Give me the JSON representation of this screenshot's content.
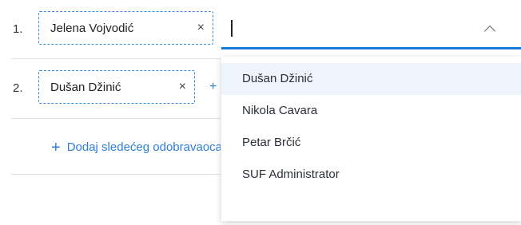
{
  "rows": [
    {
      "number": "1.",
      "person": "Jelena Vojvodić",
      "remove_glyph": "×"
    },
    {
      "number": "2.",
      "person": "Dušan Džinić",
      "remove_glyph": "×"
    }
  ],
  "add_next": {
    "plus": "+",
    "label": "Dodaj sledećeg odobravaoca"
  },
  "row2_plus_glyph": "+",
  "select": {
    "value": "",
    "open": true
  },
  "dropdown": {
    "options": [
      "Dušan Džinić",
      "Nikola Cavara",
      "Petar Brčić",
      "SUF Administrator"
    ],
    "highlighted_index": 0
  },
  "colors": {
    "accent": "#1a7ad9",
    "link": "#2f7fd8",
    "chip_border": "#3d8ad8",
    "highlight": "#edf4fb"
  },
  "icons": [
    "close-icon",
    "chevron-up-icon",
    "plus-icon"
  ]
}
